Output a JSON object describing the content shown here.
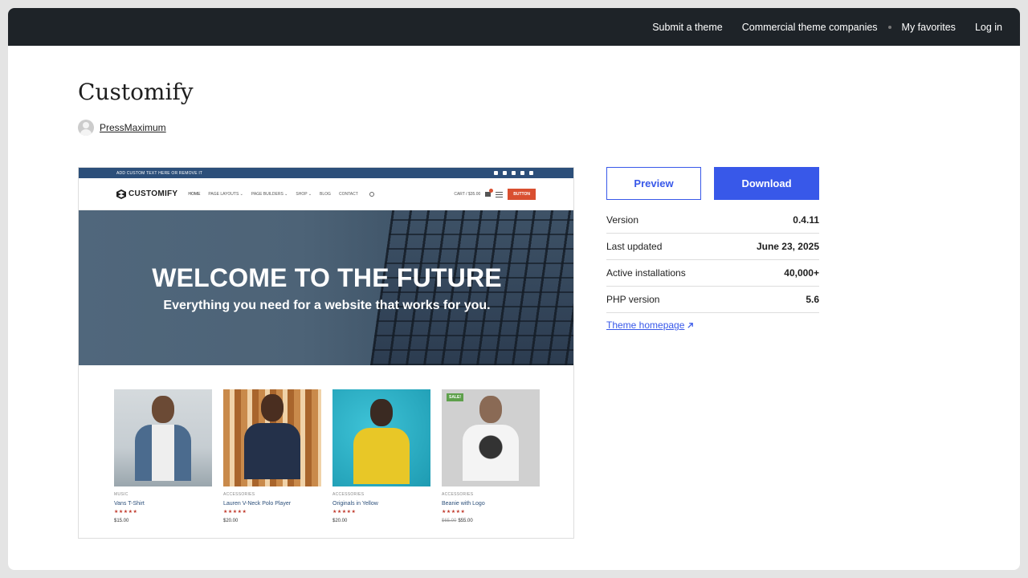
{
  "nav": {
    "items": [
      "Submit a theme",
      "Commercial theme companies",
      "My favorites",
      "Log in"
    ]
  },
  "theme": {
    "title": "Customify",
    "author": "PressMaximum"
  },
  "preview": {
    "top_strip": "ADD CUSTOM TEXT HERE OR REMOVE IT",
    "logo": "CUSTOMIFY",
    "menu": [
      "HOME",
      "PAGE LAYOUTS ⌄",
      "PAGE BUILDERS ⌄",
      "SHOP ⌄",
      "BLOG",
      "CONTACT"
    ],
    "cart": "CART / $35.00",
    "button": "BUTTON",
    "hero_title": "WELCOME TO THE FUTURE",
    "hero_subtitle": "Everything you need for a website that works for you.",
    "products": [
      {
        "category": "MUSIC",
        "name": "Vans T-Shirt",
        "stars": "★★★★★",
        "old_price": "",
        "price": "$15.00"
      },
      {
        "category": "ACCESSORIES",
        "name": "Lauren V-Neck Polo Player",
        "stars": "★★★★★",
        "old_price": "",
        "price": "$20.00"
      },
      {
        "category": "ACCESSORIES",
        "name": "Originals in Yellow",
        "stars": "★★★★★",
        "old_price": "",
        "price": "$20.00"
      },
      {
        "category": "ACCESSORIES",
        "name": "Beanie with Logo",
        "stars": "★★★★★",
        "old_price": "$65.00",
        "price": "$55.00",
        "badge": "SALE!"
      }
    ]
  },
  "actions": {
    "preview": "Preview",
    "download": "Download"
  },
  "meta": [
    {
      "label": "Version",
      "value": "0.4.11"
    },
    {
      "label": "Last updated",
      "value": "June 23, 2025"
    },
    {
      "label": "Active installations",
      "value": "40,000+"
    },
    {
      "label": "PHP version",
      "value": "5.6"
    }
  ],
  "homepage_link": "Theme homepage",
  "colors": {
    "accent": "#3858e9",
    "topbar": "#1e2328",
    "preview_strip": "#2c4f7a",
    "preview_button": "#d94f30"
  }
}
